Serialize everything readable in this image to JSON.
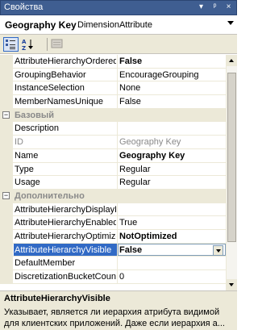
{
  "window": {
    "title": "Свойства",
    "controls": [
      "▾",
      "ᵖ",
      "×"
    ]
  },
  "object": {
    "name": "Geography Key",
    "type": "DimensionAttribute"
  },
  "toolbar": {
    "buttons": [
      "categorized-icon",
      "alphabetical-icon",
      "property-pages-icon"
    ]
  },
  "grid": {
    "rows": [
      {
        "kind": "prop",
        "name": "AttributeHierarchyOrdered",
        "value": "False",
        "bold": true
      },
      {
        "kind": "prop",
        "name": "GroupingBehavior",
        "value": "EncourageGrouping"
      },
      {
        "kind": "prop",
        "name": "InstanceSelection",
        "value": "None"
      },
      {
        "kind": "prop",
        "name": "MemberNamesUnique",
        "value": "False"
      },
      {
        "kind": "cat",
        "name": "Базовый",
        "expander": "−"
      },
      {
        "kind": "prop",
        "name": "Description",
        "value": ""
      },
      {
        "kind": "prop",
        "name": "ID",
        "value": "Geography Key",
        "grey": true
      },
      {
        "kind": "prop",
        "name": "Name",
        "value": "Geography Key",
        "bold": true
      },
      {
        "kind": "prop",
        "name": "Type",
        "value": "Regular"
      },
      {
        "kind": "prop",
        "name": "Usage",
        "value": "Regular"
      },
      {
        "kind": "cat",
        "name": "Дополнительно",
        "expander": "−"
      },
      {
        "kind": "prop",
        "name": "AttributeHierarchyDisplayFolder",
        "value": ""
      },
      {
        "kind": "prop",
        "name": "AttributeHierarchyEnabled",
        "value": "True"
      },
      {
        "kind": "prop",
        "name": "AttributeHierarchyOptimizedState",
        "value": "NotOptimized",
        "bold": true
      },
      {
        "kind": "sel",
        "name": "AttributeHierarchyVisible",
        "value": "False"
      },
      {
        "kind": "prop",
        "name": "DefaultMember",
        "value": ""
      },
      {
        "kind": "prop",
        "name": "DiscretizationBucketCount",
        "value": "0"
      }
    ]
  },
  "description": {
    "title": "AttributeHierarchyVisible",
    "text": "Указывает, является ли иерархия атрибута видимой для клиентских приложений. Даже если иерархия а..."
  }
}
